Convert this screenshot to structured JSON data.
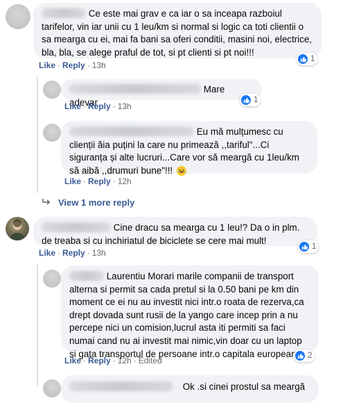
{
  "comments": [
    {
      "text": "Ce este mai grav e ca iar o sa inceapa razboiul tarifelor, vin iar unii cu 1 leu/km si normal si logic ca toti clientii o sa mearga cu ei, mai fa bani sa oferi conditii, masini noi, electrice, bla, bla, se alege praful de tot, si pt clienti si pt noi!!!",
      "like": "Like",
      "reply": "Reply",
      "time": "13h",
      "reactions": "1"
    },
    {
      "text": "Mare adevar",
      "like": "Like",
      "reply": "Reply",
      "time": "13h",
      "reactions": "1"
    },
    {
      "text": "Eu mă mulțumesc cu clienții ăia puțini la care nu primează ,,tariful\"...Ci siguranța și alte lucruri...Care vor să meargă cu 1leu/km să aibă ,,drumuri bune\"!!!",
      "like": "Like",
      "reply": "Reply",
      "time": "12h"
    },
    {
      "text": "Cine dracu sa mearga cu 1 leu!? Da o in plm. de treaba si cu inchiriatul de biciclete se cere mai mult!",
      "like": "Like",
      "reply": "Reply",
      "time": "13h",
      "reactions": "1"
    },
    {
      "text": "Laurentiu Morari marile companii de transport alterna si permit sa cada pretul si la 0.50 bani pe km din moment ce ei nu au investit nici intr.o roata de rezerva,ca drept dovada sunt rusii de la yango care incep prin a nu percepe nici un comision,lucrul asta iti permiti sa faci numai cand nu ai investit mai nimic,vin doar cu un laptop si gata transportul de persoane intr.o capitala europeana.",
      "like": "Like",
      "reply": "Reply",
      "time": "12h",
      "edited": "Edited",
      "reactions": "2"
    },
    {
      "text": "Ok .si cinei prostul sa meargă"
    }
  ],
  "view_more": "View 1 more reply",
  "colors": {
    "link": "#3a5a96",
    "bubble": "#f0f2f5",
    "like_blue": "#1877f2"
  },
  "icons": [
    "like-icon",
    "haha-icon",
    "reply-arrow-icon"
  ]
}
